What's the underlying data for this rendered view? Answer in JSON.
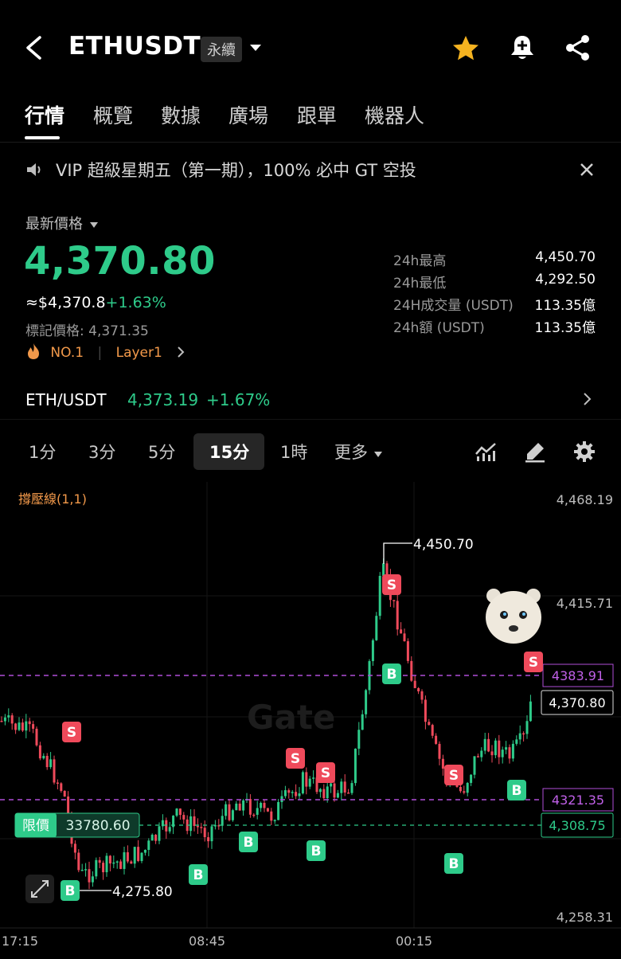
{
  "header": {
    "symbol": "ETHUSDT",
    "contract_type": "永續",
    "icons": [
      "back-arrow-icon",
      "chevron-down-icon",
      "star-icon",
      "bell-plus-icon",
      "share-icon"
    ]
  },
  "tabs": [
    "行情",
    "概覽",
    "數據",
    "廣場",
    "跟單",
    "機器人"
  ],
  "active_tab": "行情",
  "banner": {
    "text": "VIP 超級星期五（第一期），100% 必中 GT 空投",
    "icons": [
      "speaker-icon",
      "close-icon"
    ]
  },
  "price": {
    "label": "最新價格",
    "last": "4,370.80",
    "approx_usd": "≈$4,370.8",
    "change": "+1.63%",
    "mark_price": "標記價格: 4,371.35",
    "rank": "NO.1",
    "sector": "Layer1"
  },
  "stats": [
    {
      "label": "24h最高",
      "value": "4,450.70"
    },
    {
      "label": "24h最低",
      "value": "4,292.50"
    },
    {
      "label": "24H成交量 (USDT)",
      "value": "113.35億"
    },
    {
      "label": "24h額 (USDT)",
      "value": "113.35億"
    }
  ],
  "spot_pair": {
    "name": "ETH/USDT",
    "price": "4,373.19",
    "change": "+1.67%"
  },
  "intervals": [
    "1分",
    "3分",
    "5分",
    "15分",
    "1時",
    "更多"
  ],
  "active_interval": "15分",
  "chart": {
    "indicator_label": "撐壓線(1,1)",
    "watermark": "Gate",
    "price_axis": [
      "4,468.19",
      "4,415.71",
      "4,258.31"
    ],
    "time_axis": [
      "17:15",
      "08:45",
      "00:15"
    ],
    "high_marker": "4,450.70",
    "low_marker": "4,275.80",
    "resistance_tag": "4383.91",
    "support_tag": "4321.35",
    "current_price_tag": "4,370.80",
    "position_line_tag": "4,308.75",
    "limit_order_label": "限價",
    "limit_order_value": "33780.60",
    "buy_marker": "B",
    "sell_marker": "S",
    "colors": {
      "up": "#2ecb8a",
      "down": "#ef4a5b",
      "dash_purple": "#b04ed8",
      "dash_green": "#2ecb8a"
    }
  },
  "chart_data": {
    "type": "candlestick",
    "y_range": [
      4258.31,
      4468.19
    ],
    "x_ticks": [
      "17:15",
      "08:45",
      "00:15"
    ],
    "support_resistance": [
      4383.91,
      4321.35
    ],
    "last": 4370.8,
    "high": 4450.7,
    "low": 4275.8
  }
}
